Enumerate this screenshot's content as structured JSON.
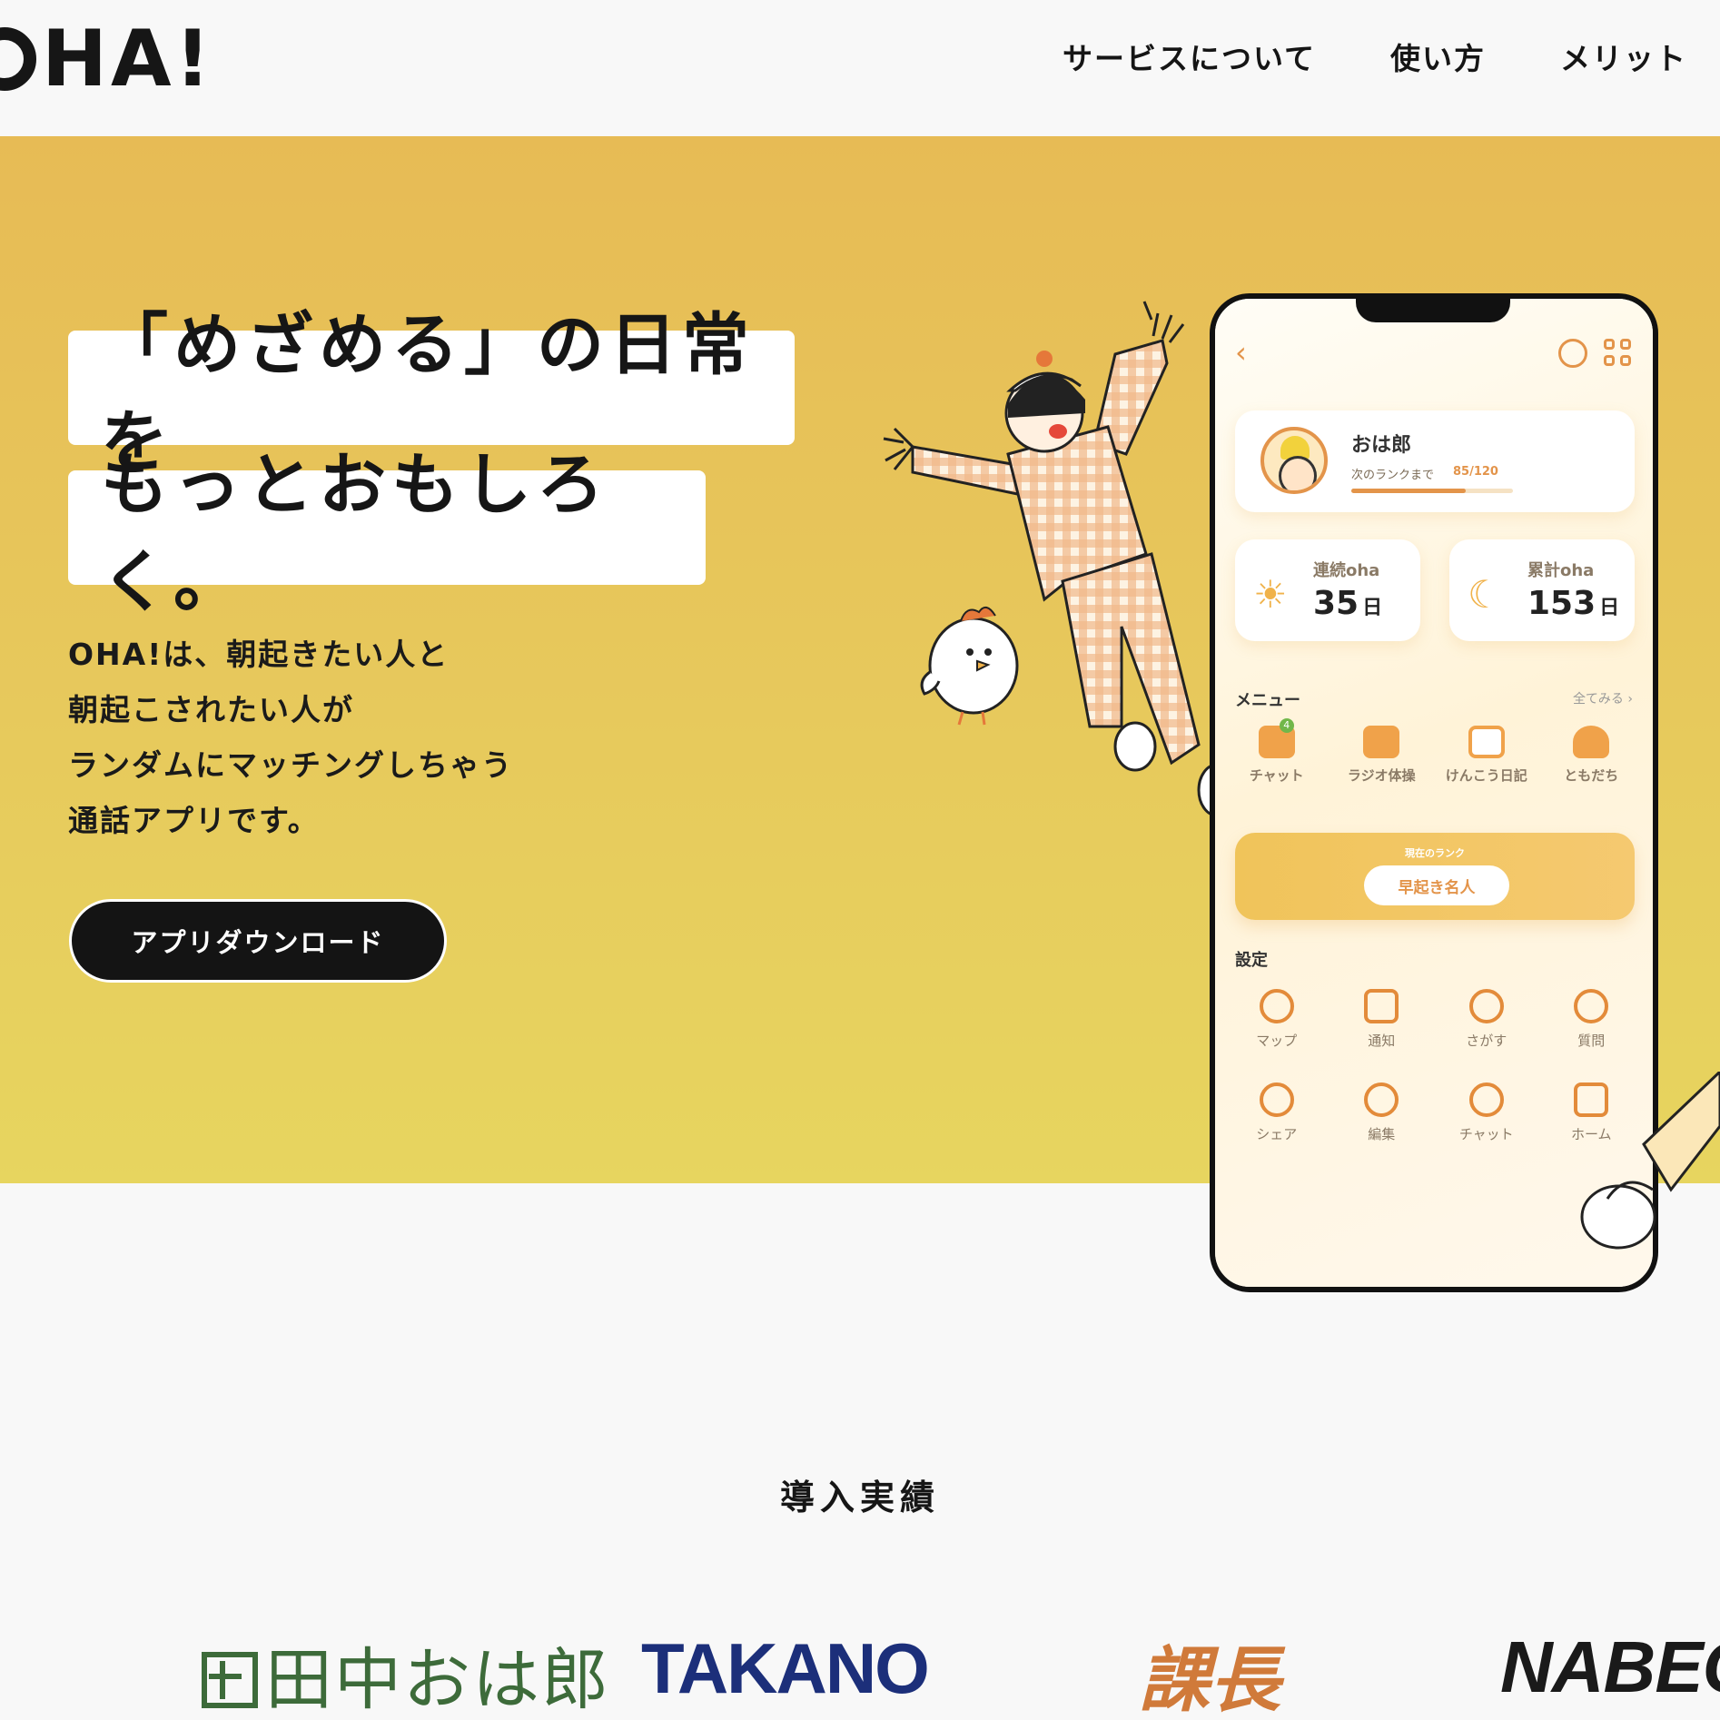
{
  "header": {
    "logo": "OHA!",
    "nav": [
      "サービスについて",
      "使い方",
      "メリット"
    ]
  },
  "hero": {
    "headline_line1": "「めざめる」の日常を",
    "headline_line2": "もっとおもしろく。",
    "lead_lines": [
      "OHA!は、朝起きたい人と",
      "朝起こされたい人が",
      "ランダムにマッチングしちゃう",
      "通話アプリです。"
    ],
    "download_button": "アプリダウンロード",
    "background_colors": [
      "#e7bb55",
      "#e7d55f"
    ]
  },
  "phone": {
    "profile": {
      "name": "おは郎",
      "rank_label": "次のランクまで",
      "rank_value": "85/120",
      "rank_progress": 0.7083
    },
    "stats": [
      {
        "label": "連続oha",
        "value": "35",
        "unit": "日",
        "icon": "sunrise-icon"
      },
      {
        "label": "累計oha",
        "value": "153",
        "unit": "日",
        "icon": "moon-icon"
      }
    ],
    "menu_title": "メニュー",
    "see_all": "全てみる ›",
    "menu": [
      {
        "label": "チャット",
        "icon": "chat-icon",
        "badge": "4"
      },
      {
        "label": "ラジオ体操",
        "icon": "calendar-icon"
      },
      {
        "label": "けんこう日記",
        "icon": "book-icon"
      },
      {
        "label": "ともだち",
        "icon": "person-icon"
      }
    ],
    "rank_banner_small": "現在のランク",
    "rank_banner_title": "早起き名人",
    "settings_title": "設定",
    "settings": [
      {
        "label": "マップ",
        "icon": "map-pin-icon"
      },
      {
        "label": "通知",
        "icon": "bell-icon"
      },
      {
        "label": "さがす",
        "icon": "search-icon"
      },
      {
        "label": "質問",
        "icon": "question-icon"
      },
      {
        "label": "シェア",
        "icon": "share-icon"
      },
      {
        "label": "編集",
        "icon": "gear-icon"
      },
      {
        "label": "チャット",
        "icon": "chat-icon"
      },
      {
        "label": "ホーム",
        "icon": "home-icon"
      }
    ],
    "accent": "#e3944a"
  },
  "clients_section": {
    "title": "導入実績",
    "clients": [
      "田中おは郎",
      "TAKANO",
      "課長",
      "NABECY"
    ]
  }
}
